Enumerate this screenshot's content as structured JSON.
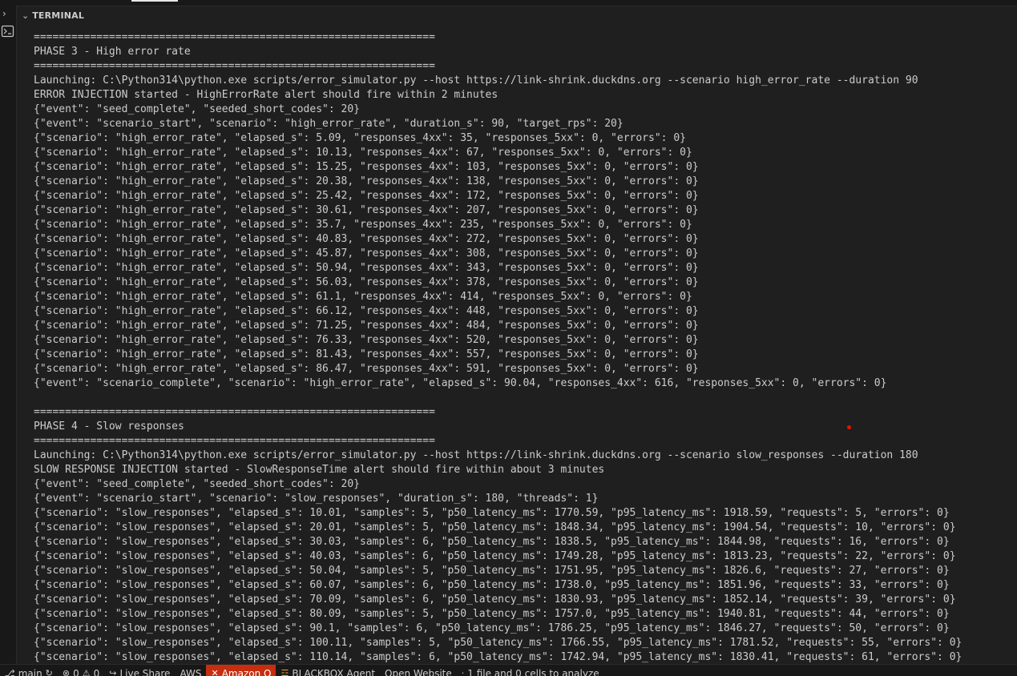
{
  "panel": {
    "title": "TERMINAL"
  },
  "terminal_lines": [
    "================================================================",
    "PHASE 3 - High error rate",
    "================================================================",
    "Launching: C:\\Python314\\python.exe scripts/error_simulator.py --host https://link-shrink.duckdns.org --scenario high_error_rate --duration 90",
    "ERROR INJECTION started - HighErrorRate alert should fire within 2 minutes",
    "{\"event\": \"seed_complete\", \"seeded_short_codes\": 20}",
    "{\"event\": \"scenario_start\", \"scenario\": \"high_error_rate\", \"duration_s\": 90, \"target_rps\": 20}",
    "{\"scenario\": \"high_error_rate\", \"elapsed_s\": 5.09, \"responses_4xx\": 35, \"responses_5xx\": 0, \"errors\": 0}",
    "{\"scenario\": \"high_error_rate\", \"elapsed_s\": 10.13, \"responses_4xx\": 67, \"responses_5xx\": 0, \"errors\": 0}",
    "{\"scenario\": \"high_error_rate\", \"elapsed_s\": 15.25, \"responses_4xx\": 103, \"responses_5xx\": 0, \"errors\": 0}",
    "{\"scenario\": \"high_error_rate\", \"elapsed_s\": 20.38, \"responses_4xx\": 138, \"responses_5xx\": 0, \"errors\": 0}",
    "{\"scenario\": \"high_error_rate\", \"elapsed_s\": 25.42, \"responses_4xx\": 172, \"responses_5xx\": 0, \"errors\": 0}",
    "{\"scenario\": \"high_error_rate\", \"elapsed_s\": 30.61, \"responses_4xx\": 207, \"responses_5xx\": 0, \"errors\": 0}",
    "{\"scenario\": \"high_error_rate\", \"elapsed_s\": 35.7, \"responses_4xx\": 235, \"responses_5xx\": 0, \"errors\": 0}",
    "{\"scenario\": \"high_error_rate\", \"elapsed_s\": 40.83, \"responses_4xx\": 272, \"responses_5xx\": 0, \"errors\": 0}",
    "{\"scenario\": \"high_error_rate\", \"elapsed_s\": 45.87, \"responses_4xx\": 308, \"responses_5xx\": 0, \"errors\": 0}",
    "{\"scenario\": \"high_error_rate\", \"elapsed_s\": 50.94, \"responses_4xx\": 343, \"responses_5xx\": 0, \"errors\": 0}",
    "{\"scenario\": \"high_error_rate\", \"elapsed_s\": 56.03, \"responses_4xx\": 378, \"responses_5xx\": 0, \"errors\": 0}",
    "{\"scenario\": \"high_error_rate\", \"elapsed_s\": 61.1, \"responses_4xx\": 414, \"responses_5xx\": 0, \"errors\": 0}",
    "{\"scenario\": \"high_error_rate\", \"elapsed_s\": 66.12, \"responses_4xx\": 448, \"responses_5xx\": 0, \"errors\": 0}",
    "{\"scenario\": \"high_error_rate\", \"elapsed_s\": 71.25, \"responses_4xx\": 484, \"responses_5xx\": 0, \"errors\": 0}",
    "{\"scenario\": \"high_error_rate\", \"elapsed_s\": 76.33, \"responses_4xx\": 520, \"responses_5xx\": 0, \"errors\": 0}",
    "{\"scenario\": \"high_error_rate\", \"elapsed_s\": 81.43, \"responses_4xx\": 557, \"responses_5xx\": 0, \"errors\": 0}",
    "{\"scenario\": \"high_error_rate\", \"elapsed_s\": 86.47, \"responses_4xx\": 591, \"responses_5xx\": 0, \"errors\": 0}",
    "{\"event\": \"scenario_complete\", \"scenario\": \"high_error_rate\", \"elapsed_s\": 90.04, \"responses_4xx\": 616, \"responses_5xx\": 0, \"errors\": 0}",
    "",
    "================================================================",
    "PHASE 4 - Slow responses",
    "================================================================",
    "Launching: C:\\Python314\\python.exe scripts/error_simulator.py --host https://link-shrink.duckdns.org --scenario slow_responses --duration 180",
    "SLOW RESPONSE INJECTION started - SlowResponseTime alert should fire within about 3 minutes",
    "{\"event\": \"seed_complete\", \"seeded_short_codes\": 20}",
    "{\"event\": \"scenario_start\", \"scenario\": \"slow_responses\", \"duration_s\": 180, \"threads\": 1}",
    "{\"scenario\": \"slow_responses\", \"elapsed_s\": 10.01, \"samples\": 5, \"p50_latency_ms\": 1770.59, \"p95_latency_ms\": 1918.59, \"requests\": 5, \"errors\": 0}",
    "{\"scenario\": \"slow_responses\", \"elapsed_s\": 20.01, \"samples\": 5, \"p50_latency_ms\": 1848.34, \"p95_latency_ms\": 1904.54, \"requests\": 10, \"errors\": 0}",
    "{\"scenario\": \"slow_responses\", \"elapsed_s\": 30.03, \"samples\": 6, \"p50_latency_ms\": 1838.5, \"p95_latency_ms\": 1844.98, \"requests\": 16, \"errors\": 0}",
    "{\"scenario\": \"slow_responses\", \"elapsed_s\": 40.03, \"samples\": 6, \"p50_latency_ms\": 1749.28, \"p95_latency_ms\": 1813.23, \"requests\": 22, \"errors\": 0}",
    "{\"scenario\": \"slow_responses\", \"elapsed_s\": 50.04, \"samples\": 5, \"p50_latency_ms\": 1751.95, \"p95_latency_ms\": 1826.6, \"requests\": 27, \"errors\": 0}",
    "{\"scenario\": \"slow_responses\", \"elapsed_s\": 60.07, \"samples\": 6, \"p50_latency_ms\": 1738.0, \"p95_latency_ms\": 1851.96, \"requests\": 33, \"errors\": 0}",
    "{\"scenario\": \"slow_responses\", \"elapsed_s\": 70.09, \"samples\": 6, \"p50_latency_ms\": 1830.93, \"p95_latency_ms\": 1852.14, \"requests\": 39, \"errors\": 0}",
    "{\"scenario\": \"slow_responses\", \"elapsed_s\": 80.09, \"samples\": 5, \"p50_latency_ms\": 1757.0, \"p95_latency_ms\": 1940.81, \"requests\": 44, \"errors\": 0}",
    "{\"scenario\": \"slow_responses\", \"elapsed_s\": 90.1, \"samples\": 6, \"p50_latency_ms\": 1786.25, \"p95_latency_ms\": 1846.27, \"requests\": 50, \"errors\": 0}",
    "{\"scenario\": \"slow_responses\", \"elapsed_s\": 100.11, \"samples\": 5, \"p50_latency_ms\": 1766.55, \"p95_latency_ms\": 1781.52, \"requests\": 55, \"errors\": 0}",
    "{\"scenario\": \"slow_responses\", \"elapsed_s\": 110.14, \"samples\": 6, \"p50_latency_ms\": 1742.94, \"p95_latency_ms\": 1830.41, \"requests\": 61, \"errors\": 0}"
  ],
  "statusbar": {
    "branch": "main",
    "errors": "0",
    "warnings": "0",
    "live_share": "Live Share",
    "aws": "AWS",
    "amazon_q": "Amazon Q",
    "blackbox": "BLACKBOX Agent",
    "open_website": "Open Website",
    "analyze": "1 file and 0 cells to analyze"
  },
  "icons": {
    "branch": "git-branch-icon",
    "sync": "sync-icon",
    "error": "error-circle-icon",
    "warning": "warning-triangle-icon",
    "live_share": "live-share-icon",
    "amazon_q": "close-x-icon",
    "blackbox": "fire-icon",
    "analyze": "dot-icon"
  },
  "colors": {
    "background": "#1f1f1f",
    "text": "#cccccc",
    "amazon_q_bg": "#c72e0f",
    "cursor_dot": "#e51400"
  }
}
